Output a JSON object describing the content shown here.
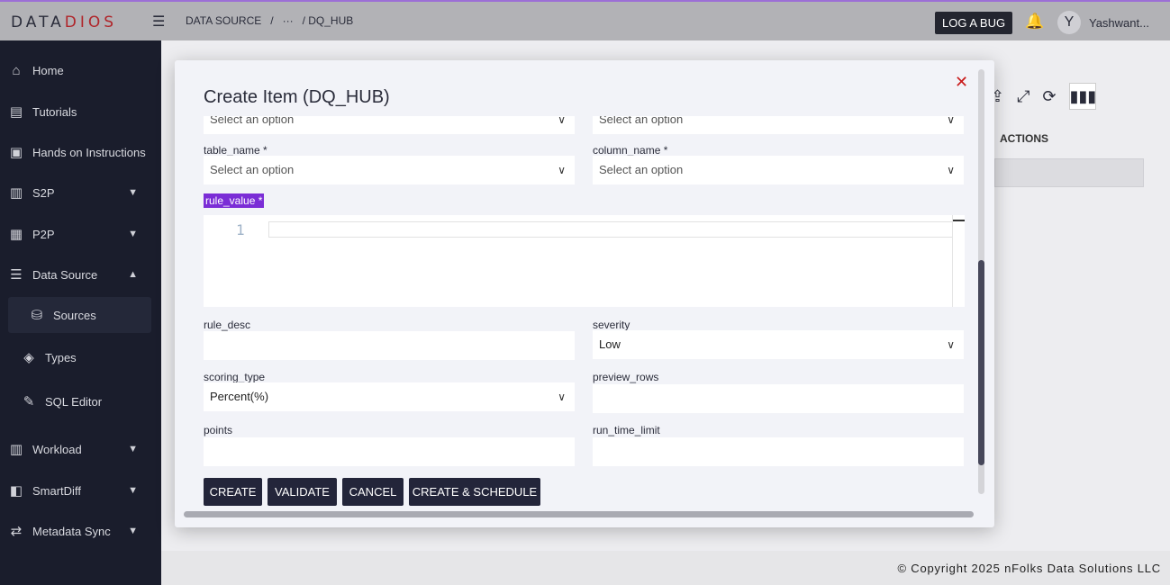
{
  "topbar": {
    "logo_a": "DATA",
    "logo_b": "DIOS",
    "breadcrumb": [
      "DATA SOURCE",
      "/",
      "···",
      "/ DQ_HUB"
    ],
    "log_bug": "LOG A BUG",
    "avatar_letter": "Y",
    "user_name": "Yashwant..."
  },
  "sidebar": {
    "items": [
      {
        "label": "Home",
        "icon": "home-icon"
      },
      {
        "label": "Tutorials",
        "icon": "book-icon"
      },
      {
        "label": "Hands on Instructions",
        "icon": "code-box-icon"
      },
      {
        "label": "S2P",
        "icon": "s2p-icon"
      },
      {
        "label": "P2P",
        "icon": "p2p-icon"
      },
      {
        "label": "Data Source",
        "icon": "server-icon"
      },
      {
        "label": "Sources",
        "icon": "database-icon"
      },
      {
        "label": "Types",
        "icon": "layers-icon"
      },
      {
        "label": "SQL Editor",
        "icon": "edit-icon"
      },
      {
        "label": "Workload",
        "icon": "workload-icon"
      },
      {
        "label": "SmartDiff",
        "icon": "diff-icon"
      },
      {
        "label": "Metadata Sync",
        "icon": "sync-icon"
      }
    ]
  },
  "background": {
    "actions_header": "ACTIONS"
  },
  "footer": {
    "copyright": "© Copyright 2025 nFolks Data Solutions LLC"
  },
  "modal": {
    "title": "Create Item (DQ_HUB)",
    "top_select_left": "Select an option",
    "top_select_right": "Select an option",
    "table_name_label": "table_name *",
    "table_name_value": "Select an option",
    "column_name_label": "column_name *",
    "column_name_value": "Select an option",
    "rule_value_label": "rule_value *",
    "line_number": "1",
    "rule_desc_label": "rule_desc",
    "rule_desc_value": "",
    "severity_label": "severity",
    "severity_value": "Low",
    "scoring_type_label": "scoring_type",
    "scoring_type_value": "Percent(%)",
    "preview_rows_label": "preview_rows",
    "preview_rows_value": "",
    "points_label": "points",
    "points_value": "",
    "run_time_limit_label": "run_time_limit",
    "run_time_limit_value": "",
    "buttons": {
      "create": "CREATE",
      "validate": "VALIDATE",
      "cancel": "CANCEL",
      "create_schedule": "CREATE & SCHEDULE"
    }
  }
}
